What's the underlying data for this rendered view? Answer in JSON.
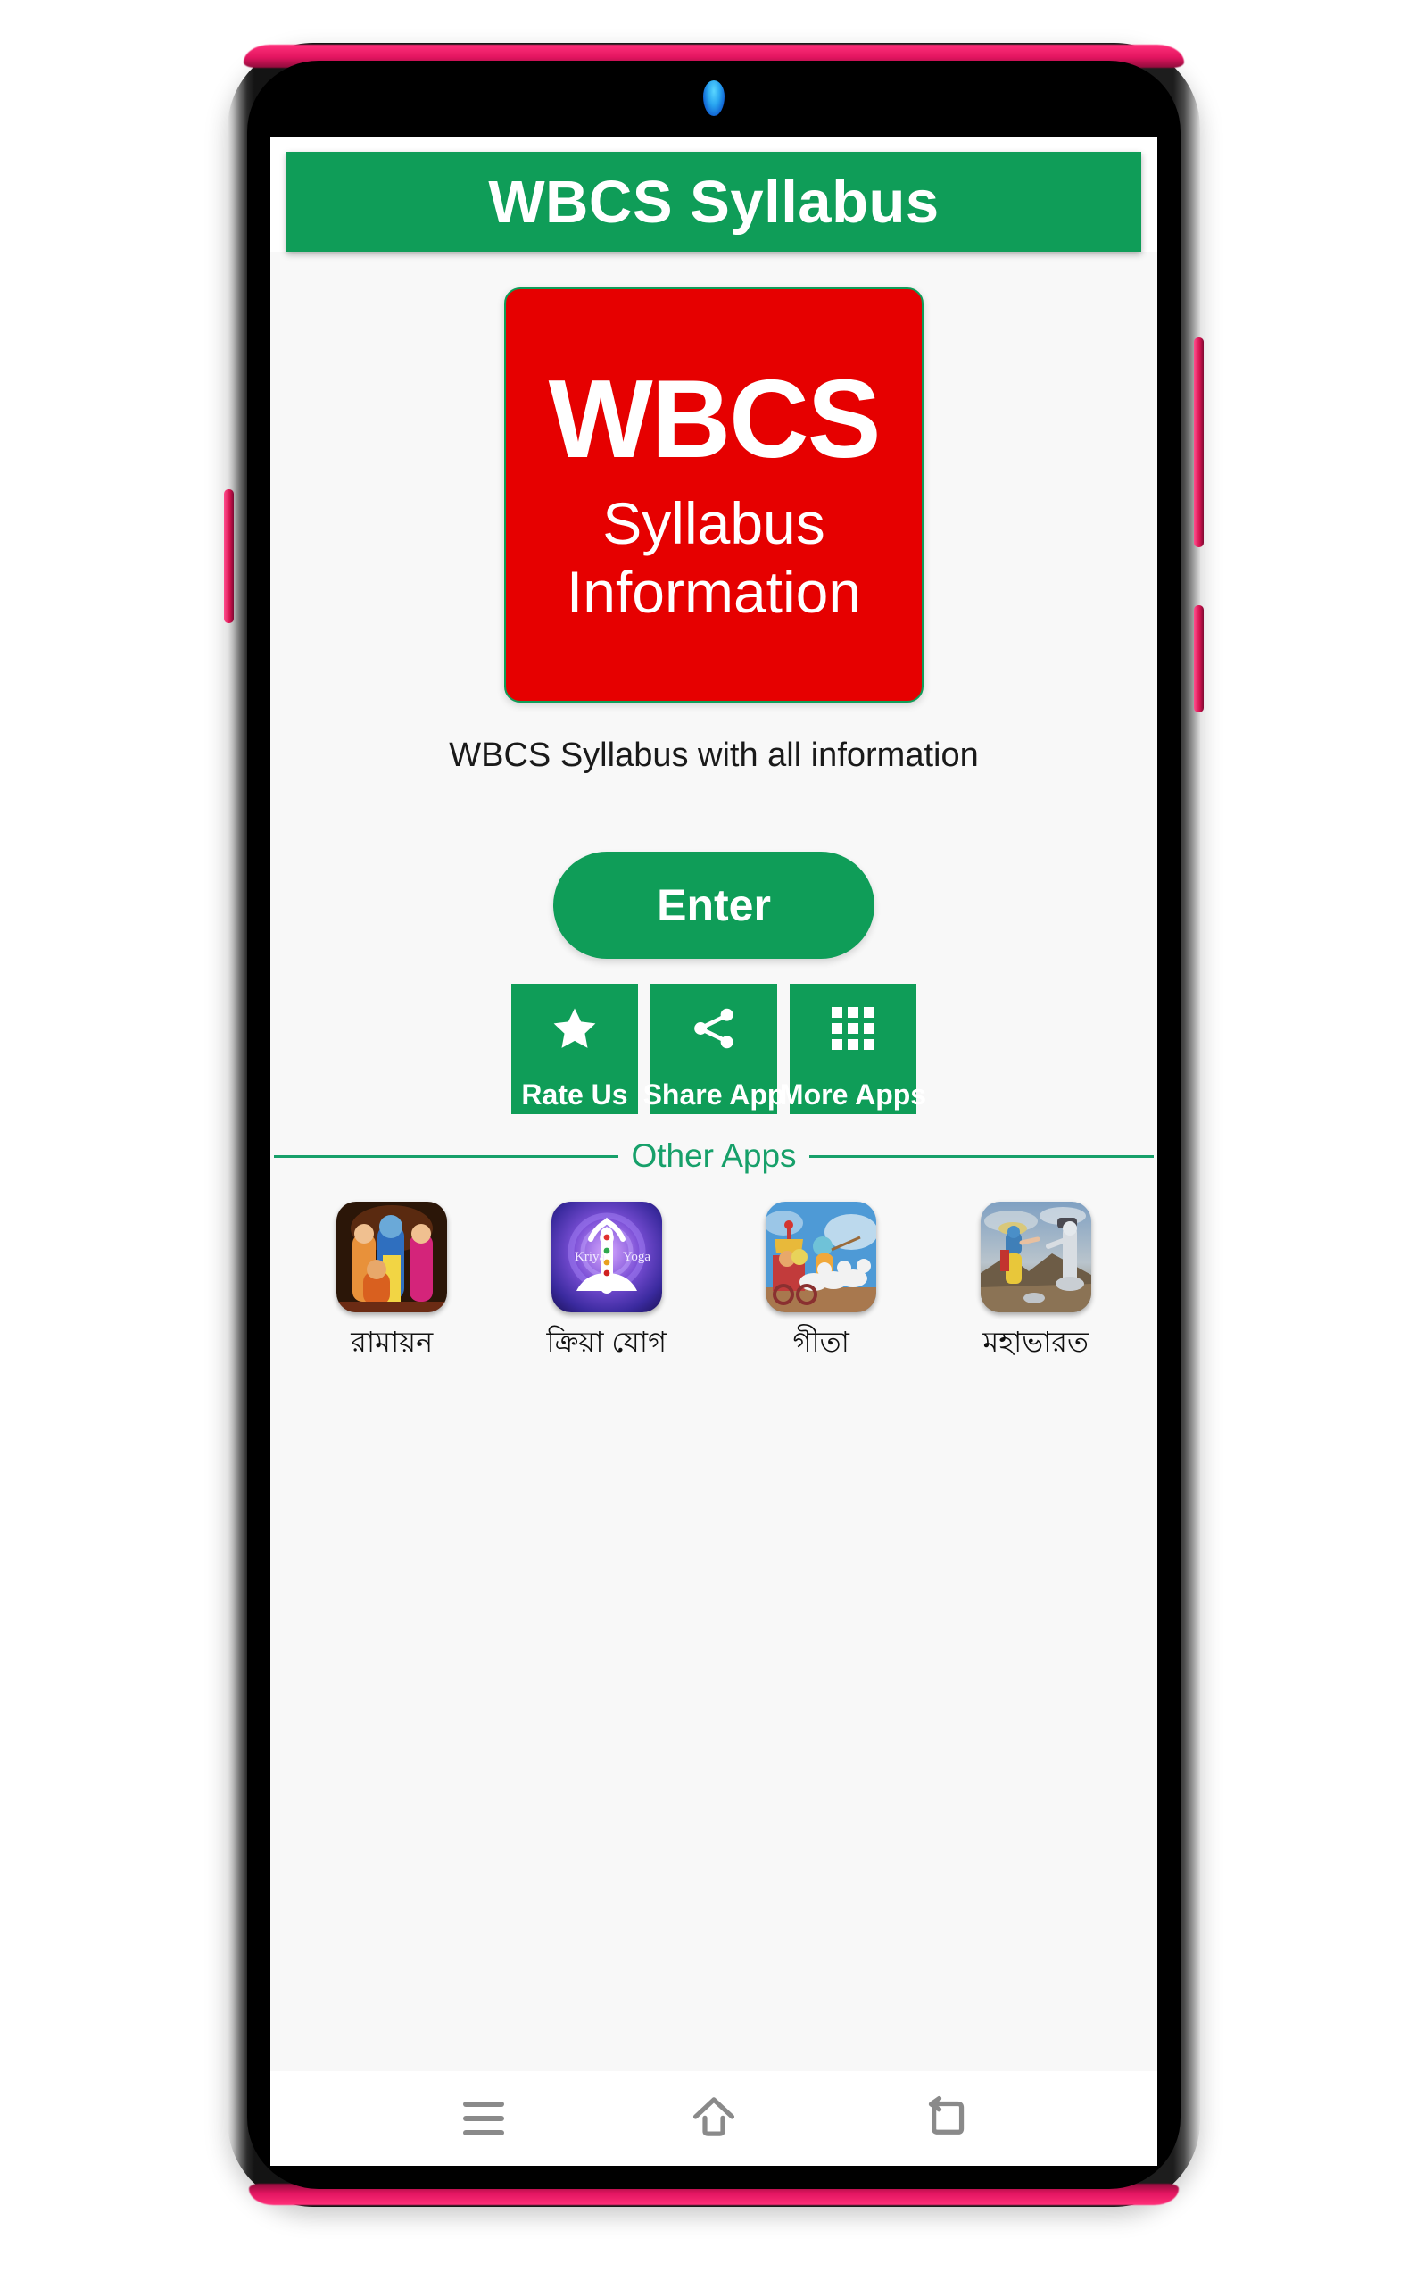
{
  "device": {
    "frame_color": "#e31560",
    "bezel_color": "#000000",
    "camera": "front-camera-lens"
  },
  "app": {
    "header": {
      "title": "WBCS Syllabus",
      "background": "#0f9d58",
      "text_color": "#ffffff"
    },
    "logo": {
      "line1": "WBCS",
      "line2": "Syllabus",
      "line3": "Information",
      "background": "#e60000",
      "border_color": "#0f9d58",
      "text_color": "#ffffff"
    },
    "subtitle": "WBCS Syllabus with all information",
    "enter_button": {
      "label": "Enter",
      "background": "#0f9d58",
      "text_color": "#ffffff"
    },
    "actions": [
      {
        "label": "Rate Us",
        "icon": "star-icon",
        "background": "#0f9d58"
      },
      {
        "label": "Share App",
        "icon": "share-icon",
        "background": "#0f9d58"
      },
      {
        "label": "More Apps",
        "icon": "grid-icon",
        "background": "#0f9d58"
      }
    ],
    "other_apps": {
      "section_label": "Other Apps",
      "accent_color": "#17a06a",
      "items": [
        {
          "label": "রামায়ন",
          "thumb": "ramayan-thumbnail",
          "overlay_text": ""
        },
        {
          "label": "ক্রিয়া যোগ",
          "thumb": "kriya-yoga-thumbnail",
          "overlay_text": "Kriya  Yoga"
        },
        {
          "label": "গীতা",
          "thumb": "gita-thumbnail",
          "overlay_text": ""
        },
        {
          "label": "মহাভারত",
          "thumb": "mahabharat-thumbnail",
          "overlay_text": ""
        }
      ]
    }
  },
  "navbar": {
    "buttons": [
      {
        "name": "recents",
        "icon": "hamburger-icon"
      },
      {
        "name": "home",
        "icon": "home-icon"
      },
      {
        "name": "back",
        "icon": "back-arrow-icon"
      }
    ]
  }
}
